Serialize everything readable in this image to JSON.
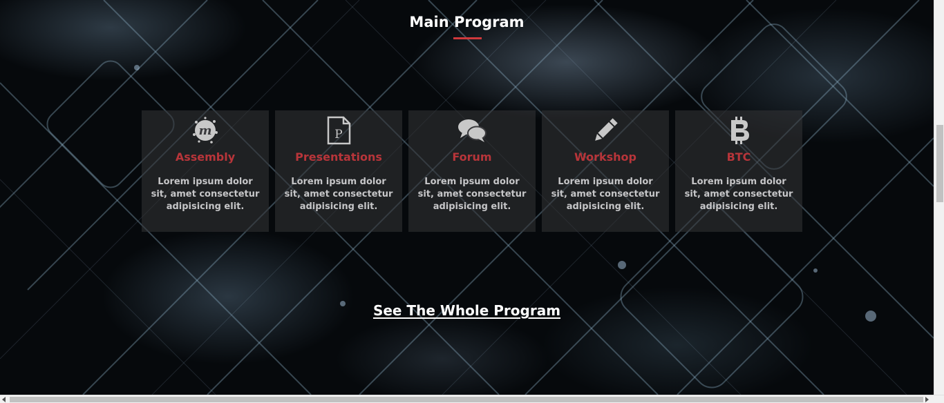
{
  "section": {
    "title": "Main Program",
    "accent_color": "#d0393c"
  },
  "cards": [
    {
      "icon": "meetup-icon",
      "title": "Assembly",
      "text": "Lorem ipsum dolor sit, amet consectetur adipisicing elit."
    },
    {
      "icon": "file-powerpoint-icon",
      "title": "Presentations",
      "text": "Lorem ipsum dolor sit, amet consectetur adipisicing elit."
    },
    {
      "icon": "comments-icon",
      "title": "Forum",
      "text": "Lorem ipsum dolor sit, amet consectetur adipisicing elit."
    },
    {
      "icon": "pencil-icon",
      "title": "Workshop",
      "text": "Lorem ipsum dolor sit, amet consectetur adipisicing elit."
    },
    {
      "icon": "bitcoin-icon",
      "title": "BTC",
      "text": "Lorem ipsum dolor sit, amet consectetur adipisicing elit."
    }
  ],
  "link": {
    "label": "See The Whole Program"
  },
  "colors": {
    "card_title": "#b8353a",
    "card_text": "#c6c6c8",
    "icon": "#c8c8c8"
  }
}
